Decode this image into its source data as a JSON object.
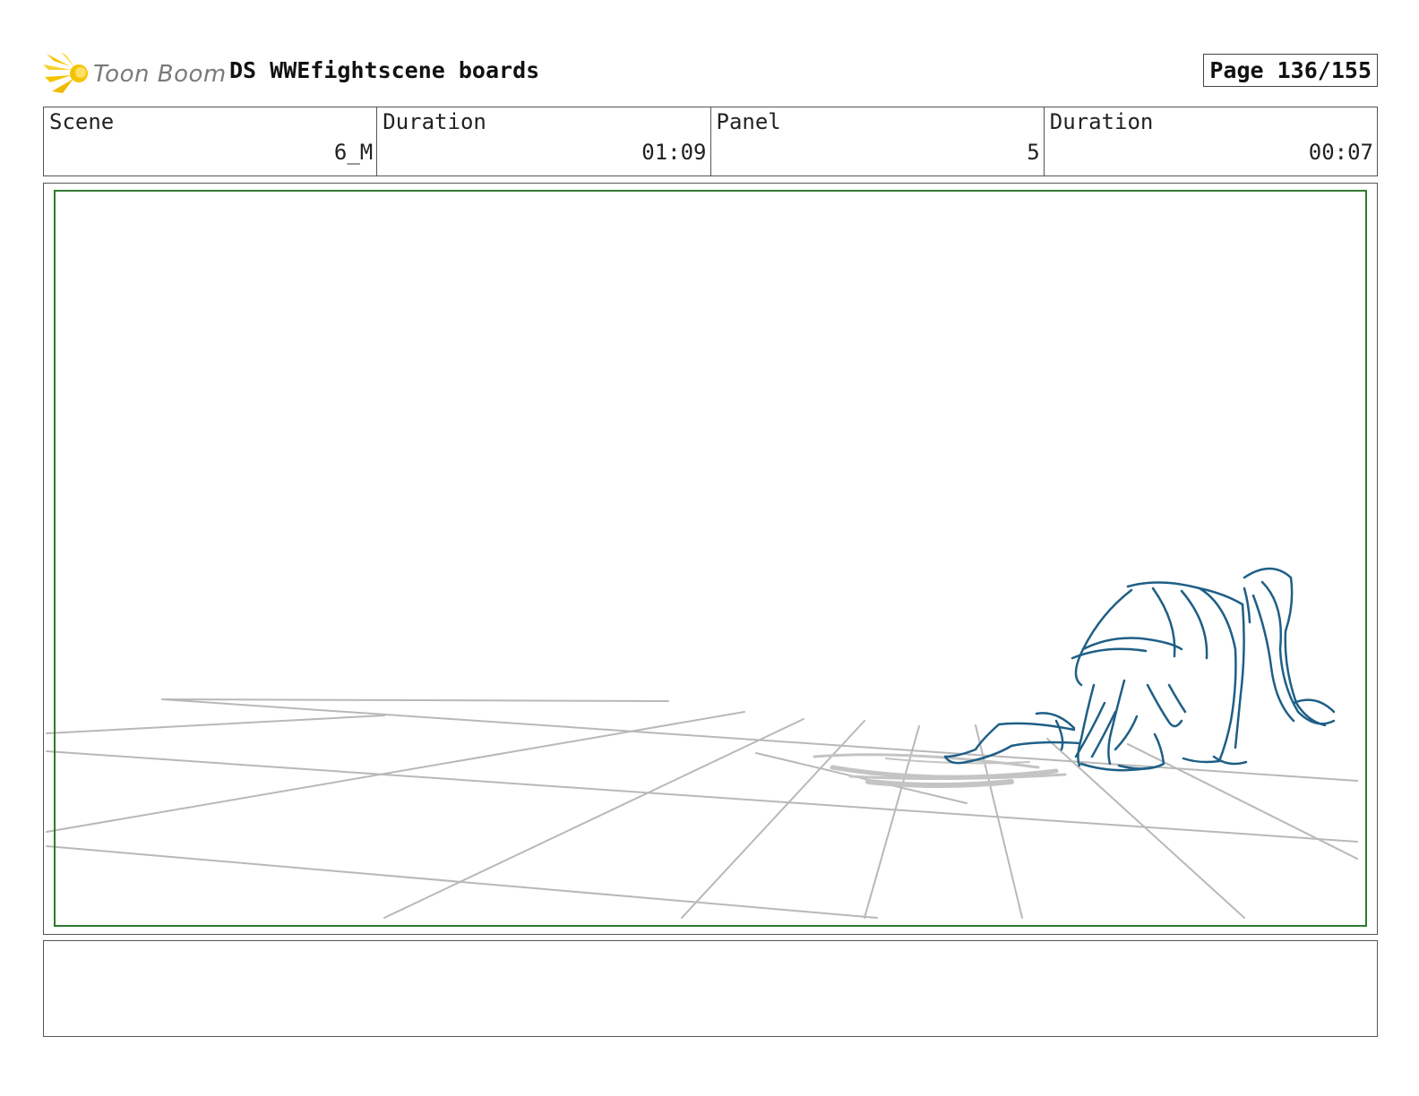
{
  "header": {
    "logo_text": "Toon Boom",
    "title": "DS WWEfightscene boards",
    "page": "Page 136/155"
  },
  "info": {
    "scene_label": "Scene",
    "scene_value": "6_M",
    "duration_label": "Duration",
    "duration_value": "01:09",
    "panel_label": "Panel",
    "panel_value": "5",
    "panel_duration_label": "Duration",
    "panel_duration_value": "00:07"
  },
  "colors": {
    "safe_area": "#2f7a2f",
    "floor_lines": "#b8b8b8",
    "character_lines": "#1f5f86",
    "logo_accent": "#f5c400"
  },
  "icons": {
    "logo": "toon-boom-burst-icon"
  },
  "notes": {
    "text": ""
  }
}
